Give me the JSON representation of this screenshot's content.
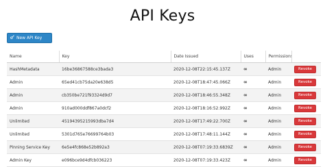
{
  "page": {
    "title": "API Keys"
  },
  "toolbar": {
    "new_key_label": "New API Key",
    "new_key_icon": "key-icon"
  },
  "table": {
    "headers": {
      "name": "Name",
      "key": "Key",
      "date": "Date Issued",
      "uses": "Uses",
      "permissions": "Permissions"
    },
    "rows": [
      {
        "name": "HashMetadata",
        "key": "16be36867588ce3bada3",
        "date": "2020-12-08T22:15:45.137Z",
        "uses": "∞",
        "permissions": "Admin",
        "action": "Revoke"
      },
      {
        "name": "Admin",
        "key": "65ed41cb75da20e638d5",
        "date": "2020-12-08T18:47:45.066Z",
        "uses": "∞",
        "permissions": "Admin",
        "action": "Revoke"
      },
      {
        "name": "Admin",
        "key": "cb350be721f93324d9d7",
        "date": "2020-12-08T18:46:55.348Z",
        "uses": "∞",
        "permissions": "Admin",
        "action": "Revoke"
      },
      {
        "name": "Admin",
        "key": "910ad000ddf867a0dcf2",
        "date": "2020-12-08T18:16:52.992Z",
        "uses": "∞",
        "permissions": "Admin",
        "action": "Revoke"
      },
      {
        "name": "Unlimited",
        "key": "45194395215993dba7d4",
        "date": "2020-12-08T17:49:22.700Z",
        "uses": "∞",
        "permissions": "Admin",
        "action": "Revoke"
      },
      {
        "name": "Unlimited",
        "key": "5301d765e76699764b03",
        "date": "2020-12-08T17:48:11.144Z",
        "uses": "∞",
        "permissions": "Admin",
        "action": "Revoke"
      },
      {
        "name": "Pinning Service Key",
        "key": "6e5e4fc868e52b892a3",
        "date": "2020-12-08T07:19:33.6839Z",
        "uses": "∞",
        "permissions": "Admin",
        "action": "Revoke"
      },
      {
        "name": "Admin Key",
        "key": "e096bce9d4dfcb036223",
        "date": "2020-12-08T07:19:33.423Z",
        "uses": "∞",
        "permissions": "Admin",
        "action": "Revoke"
      }
    ]
  },
  "colors": {
    "primary": "#2d86c7",
    "danger": "#d9383a",
    "stripe": "#f3f3f3"
  }
}
